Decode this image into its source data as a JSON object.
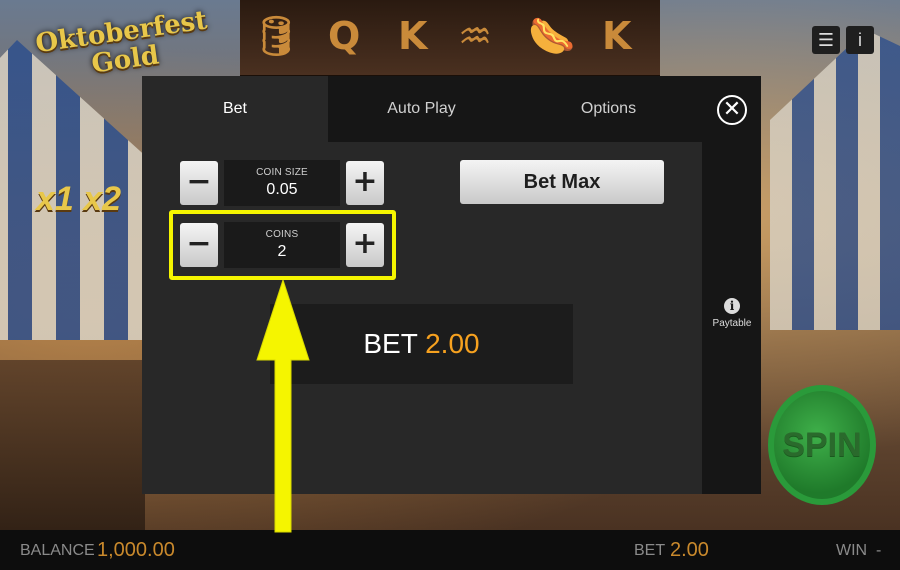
{
  "background": {
    "logo": {
      "line1": "Oktoberfest",
      "line2": "Gold"
    },
    "multipliers": "x1 x2",
    "reel_symbols": [
      "🛢",
      "Q",
      "K",
      "♒",
      "🌭",
      "K"
    ],
    "top_icons": {
      "menu": "☰",
      "info": "i"
    },
    "spin_label": "SPIN"
  },
  "panel": {
    "tabs": [
      {
        "label": "Bet",
        "active": true
      },
      {
        "label": "Auto Play",
        "active": false
      },
      {
        "label": "Options",
        "active": false
      }
    ],
    "close_symbol": "✕",
    "coin_size": {
      "caption": "COIN SIZE",
      "value": "0.05",
      "minus": "−",
      "plus": "+"
    },
    "coins": {
      "caption": "COINS",
      "value": "2",
      "minus": "−",
      "plus": "+"
    },
    "bet_max_label": "Bet Max",
    "bet_display": {
      "label": "BET",
      "amount": "2.00"
    },
    "paytable": {
      "label": "Paytable",
      "icon": "i"
    }
  },
  "bottom_bar": {
    "balance_label": "BALANCE",
    "balance_value": "1,000.00",
    "bet_label": "BET",
    "bet_value": "2.00",
    "win_label": "WIN",
    "win_value": "-"
  },
  "colors": {
    "highlight": "#f5f500",
    "bet_amount": "#f6a11f",
    "bottom_value": "#c9892c",
    "panel_bg": "#282828",
    "tab_inactive_bg": "#161616"
  }
}
